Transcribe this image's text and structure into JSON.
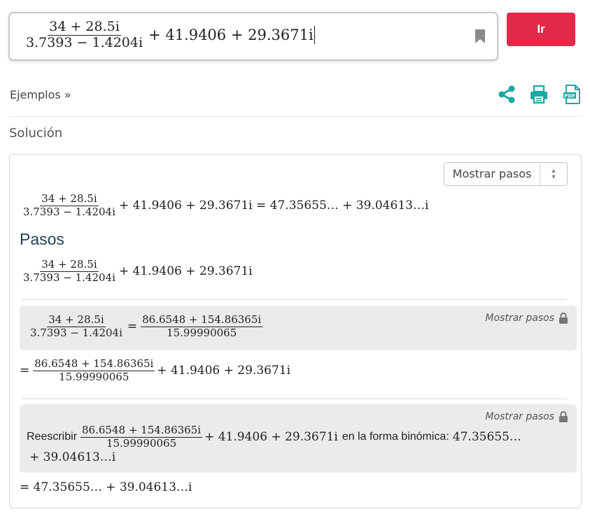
{
  "search": {
    "numerator": "34 + 28.5i",
    "denominator": "3.7393 − 1.4204i",
    "tail": "+ 41.9406 + 29.3671i"
  },
  "go_button": "Ir",
  "toolbar": {
    "examples": "Ejemplos »",
    "icons": [
      "share-icon",
      "print-icon",
      "pdf-icon"
    ],
    "pdf_label": "PDF",
    "accent": "#1aa8a2"
  },
  "brand_color": "#e2294a",
  "solution": {
    "title": "Solución",
    "steps_select": "Mostrar pasos",
    "result_line": {
      "numerator": "34 + 28.5i",
      "denominator": "3.7393 − 1.4204i",
      "rhs": "+ 41.9406 + 29.3671i = 47.35655… + 39.04613…i"
    },
    "pasos_heading": "Pasos",
    "expr_line": {
      "numerator": "34 + 28.5i",
      "denominator": "3.7393 − 1.4204i",
      "tail": "+ 41.9406 + 29.3671i"
    },
    "step1": {
      "numerator": "34 + 28.5i",
      "denominator": "3.7393 − 1.4204i",
      "equals": "=",
      "result_numerator": "86.6548 + 154.86365i",
      "result_denominator": "15.99990065",
      "show_steps": "Mostrar pasos"
    },
    "line2": {
      "equals": "=",
      "numerator": "86.6548 + 154.86365i",
      "denominator": "15.99990065",
      "tail": "+ 41.9406 + 29.3671i"
    },
    "step2": {
      "prefix": "Reescribir",
      "numerator": "86.6548 + 154.86365i",
      "denominator": "15.99990065",
      "middle": "+ 41.9406 + 29.3671i",
      "suffix": "en la forma binómica:",
      "result_a": "47.35655…",
      "result_b": "+ 39.04613…i",
      "show_steps": "Mostrar pasos"
    },
    "final_line": "= 47.35655… + 39.04613…i"
  }
}
